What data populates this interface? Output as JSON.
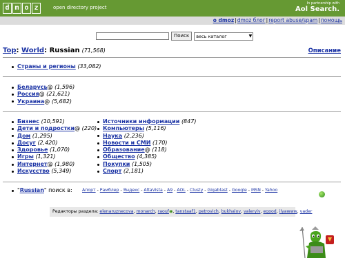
{
  "header": {
    "logo_letters": [
      "d",
      "m",
      "o",
      "z"
    ],
    "subtitle": "open directory project",
    "partner_text": "In partnership with",
    "partner_brand": "Aol Search.",
    "nav_links": [
      {
        "label": "о dmoz",
        "bold": true
      },
      {
        "label": "dmoz блог",
        "bold": false
      },
      {
        "label": "report abuse/spam",
        "bold": false
      },
      {
        "label": "помощь",
        "bold": false
      }
    ]
  },
  "search": {
    "input_value": "",
    "button_label": "Поиск",
    "scope_selected": "весь каталог"
  },
  "breadcrumb": {
    "top": "Top",
    "world": "World",
    "current": "Russian",
    "count": "(71,568)",
    "description_link": "Описание"
  },
  "section1": [
    {
      "label": "Страны и регионы",
      "count": "(33,082)",
      "at": false
    }
  ],
  "section2": [
    {
      "label": "Беларусь",
      "count": "(1,596)",
      "at": true
    },
    {
      "label": "Россия",
      "count": "(21,621)",
      "at": true
    },
    {
      "label": "Украина",
      "count": "(5,682)",
      "at": true
    }
  ],
  "section3_left": [
    {
      "label": "Бизнес",
      "count": "(10,591)",
      "at": false
    },
    {
      "label": "Дети и подростки",
      "count": "(220)",
      "at": true
    },
    {
      "label": "Дом",
      "count": "(1,295)",
      "at": false
    },
    {
      "label": "Досуг",
      "count": "(2,420)",
      "at": false
    },
    {
      "label": "Здоровье",
      "count": "(1,070)",
      "at": false
    },
    {
      "label": "Игры",
      "count": "(1,321)",
      "at": false
    },
    {
      "label": "Интернет",
      "count": "(1,980)",
      "at": true
    },
    {
      "label": "Искусство",
      "count": "(5,349)",
      "at": false
    }
  ],
  "section3_right": [
    {
      "label": "Источники информации",
      "count": "(847)",
      "at": false
    },
    {
      "label": "Компьютеры",
      "count": "(5,116)",
      "at": false
    },
    {
      "label": "Наука",
      "count": "(2,236)",
      "at": false
    },
    {
      "label": "Новости и СМИ",
      "count": "(170)",
      "at": false
    },
    {
      "label": "Образование",
      "count": "(118)",
      "at": true
    },
    {
      "label": "Общество",
      "count": "(4,385)",
      "at": false
    },
    {
      "label": "Покупки",
      "count": "(1,505)",
      "at": false
    },
    {
      "label": "Спорт",
      "count": "(2,181)",
      "at": false
    }
  ],
  "also_search": {
    "term": "Russian",
    "suffix": " поиск в:",
    "engines": [
      "Апорт",
      "Рамблер",
      "Яндекс",
      "AltaVista",
      "A9",
      "AOL",
      "Clusty",
      "Gigablast",
      "Google",
      "MSN",
      "Yahoo"
    ]
  },
  "editors": {
    "label": "Редакторы раздела:",
    "names": [
      "elenaruznecova",
      "monarch",
      "raouf",
      "tanstaaf1",
      "petrovich",
      "bukhalov",
      "valeryiv",
      "egood",
      "ilyawww",
      "vader"
    ]
  }
}
